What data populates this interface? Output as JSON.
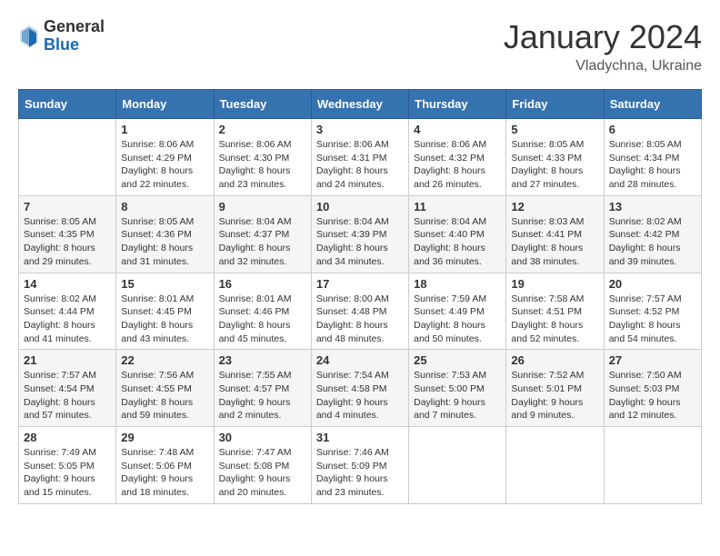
{
  "header": {
    "logo_general": "General",
    "logo_blue": "Blue",
    "month_year": "January 2024",
    "location": "Vladychna, Ukraine"
  },
  "weekdays": [
    "Sunday",
    "Monday",
    "Tuesday",
    "Wednesday",
    "Thursday",
    "Friday",
    "Saturday"
  ],
  "weeks": [
    [
      {
        "day": "",
        "info": ""
      },
      {
        "day": "1",
        "info": "Sunrise: 8:06 AM\nSunset: 4:29 PM\nDaylight: 8 hours\nand 22 minutes."
      },
      {
        "day": "2",
        "info": "Sunrise: 8:06 AM\nSunset: 4:30 PM\nDaylight: 8 hours\nand 23 minutes."
      },
      {
        "day": "3",
        "info": "Sunrise: 8:06 AM\nSunset: 4:31 PM\nDaylight: 8 hours\nand 24 minutes."
      },
      {
        "day": "4",
        "info": "Sunrise: 8:06 AM\nSunset: 4:32 PM\nDaylight: 8 hours\nand 26 minutes."
      },
      {
        "day": "5",
        "info": "Sunrise: 8:05 AM\nSunset: 4:33 PM\nDaylight: 8 hours\nand 27 minutes."
      },
      {
        "day": "6",
        "info": "Sunrise: 8:05 AM\nSunset: 4:34 PM\nDaylight: 8 hours\nand 28 minutes."
      }
    ],
    [
      {
        "day": "7",
        "info": "Sunrise: 8:05 AM\nSunset: 4:35 PM\nDaylight: 8 hours\nand 29 minutes."
      },
      {
        "day": "8",
        "info": "Sunrise: 8:05 AM\nSunset: 4:36 PM\nDaylight: 8 hours\nand 31 minutes."
      },
      {
        "day": "9",
        "info": "Sunrise: 8:04 AM\nSunset: 4:37 PM\nDaylight: 8 hours\nand 32 minutes."
      },
      {
        "day": "10",
        "info": "Sunrise: 8:04 AM\nSunset: 4:39 PM\nDaylight: 8 hours\nand 34 minutes."
      },
      {
        "day": "11",
        "info": "Sunrise: 8:04 AM\nSunset: 4:40 PM\nDaylight: 8 hours\nand 36 minutes."
      },
      {
        "day": "12",
        "info": "Sunrise: 8:03 AM\nSunset: 4:41 PM\nDaylight: 8 hours\nand 38 minutes."
      },
      {
        "day": "13",
        "info": "Sunrise: 8:02 AM\nSunset: 4:42 PM\nDaylight: 8 hours\nand 39 minutes."
      }
    ],
    [
      {
        "day": "14",
        "info": "Sunrise: 8:02 AM\nSunset: 4:44 PM\nDaylight: 8 hours\nand 41 minutes."
      },
      {
        "day": "15",
        "info": "Sunrise: 8:01 AM\nSunset: 4:45 PM\nDaylight: 8 hours\nand 43 minutes."
      },
      {
        "day": "16",
        "info": "Sunrise: 8:01 AM\nSunset: 4:46 PM\nDaylight: 8 hours\nand 45 minutes."
      },
      {
        "day": "17",
        "info": "Sunrise: 8:00 AM\nSunset: 4:48 PM\nDaylight: 8 hours\nand 48 minutes."
      },
      {
        "day": "18",
        "info": "Sunrise: 7:59 AM\nSunset: 4:49 PM\nDaylight: 8 hours\nand 50 minutes."
      },
      {
        "day": "19",
        "info": "Sunrise: 7:58 AM\nSunset: 4:51 PM\nDaylight: 8 hours\nand 52 minutes."
      },
      {
        "day": "20",
        "info": "Sunrise: 7:57 AM\nSunset: 4:52 PM\nDaylight: 8 hours\nand 54 minutes."
      }
    ],
    [
      {
        "day": "21",
        "info": "Sunrise: 7:57 AM\nSunset: 4:54 PM\nDaylight: 8 hours\nand 57 minutes."
      },
      {
        "day": "22",
        "info": "Sunrise: 7:56 AM\nSunset: 4:55 PM\nDaylight: 8 hours\nand 59 minutes."
      },
      {
        "day": "23",
        "info": "Sunrise: 7:55 AM\nSunset: 4:57 PM\nDaylight: 9 hours\nand 2 minutes."
      },
      {
        "day": "24",
        "info": "Sunrise: 7:54 AM\nSunset: 4:58 PM\nDaylight: 9 hours\nand 4 minutes."
      },
      {
        "day": "25",
        "info": "Sunrise: 7:53 AM\nSunset: 5:00 PM\nDaylight: 9 hours\nand 7 minutes."
      },
      {
        "day": "26",
        "info": "Sunrise: 7:52 AM\nSunset: 5:01 PM\nDaylight: 9 hours\nand 9 minutes."
      },
      {
        "day": "27",
        "info": "Sunrise: 7:50 AM\nSunset: 5:03 PM\nDaylight: 9 hours\nand 12 minutes."
      }
    ],
    [
      {
        "day": "28",
        "info": "Sunrise: 7:49 AM\nSunset: 5:05 PM\nDaylight: 9 hours\nand 15 minutes."
      },
      {
        "day": "29",
        "info": "Sunrise: 7:48 AM\nSunset: 5:06 PM\nDaylight: 9 hours\nand 18 minutes."
      },
      {
        "day": "30",
        "info": "Sunrise: 7:47 AM\nSunset: 5:08 PM\nDaylight: 9 hours\nand 20 minutes."
      },
      {
        "day": "31",
        "info": "Sunrise: 7:46 AM\nSunset: 5:09 PM\nDaylight: 9 hours\nand 23 minutes."
      },
      {
        "day": "",
        "info": ""
      },
      {
        "day": "",
        "info": ""
      },
      {
        "day": "",
        "info": ""
      }
    ]
  ]
}
